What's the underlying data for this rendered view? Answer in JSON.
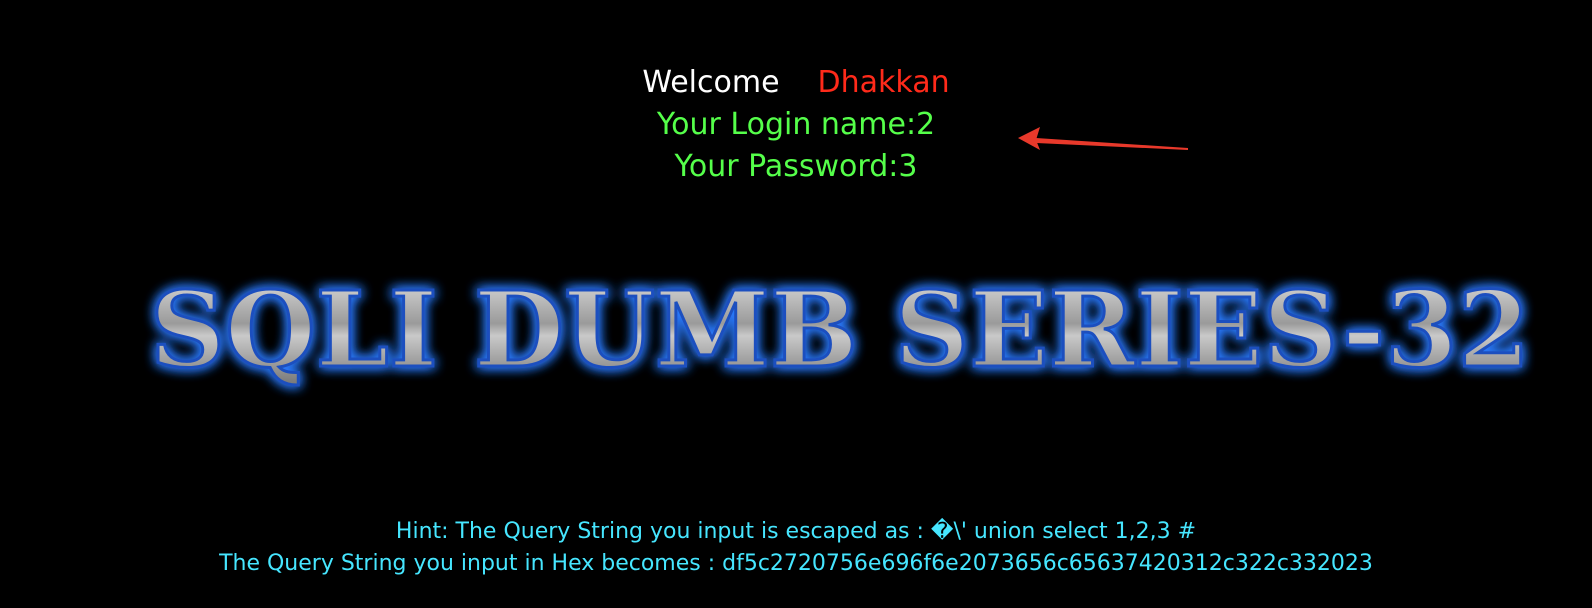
{
  "welcome": {
    "greeting": "Welcome",
    "user": "Dhakkan"
  },
  "login": {
    "name_label": "Your Login name:2",
    "password_label": "Your Password:3"
  },
  "banner": {
    "title": "SQLI DUMB SERIES-32"
  },
  "hint": {
    "escaped_text": "Hint: The Query String you input is escaped as : �\\' union select 1,2,3 #",
    "hex_text": "The Query String you input in Hex becomes : df5c2720756e696f6e2073656c65637420312c322c332023"
  },
  "colors": {
    "background": "#000000",
    "welcome": "#ffffff",
    "user": "#ff2a1a",
    "login_text": "#55ff4a",
    "hint_text": "#46e6ff",
    "arrow": "#e8392b",
    "banner_glow": "#2b7bff"
  },
  "icons": {
    "annotation": "arrow-icon"
  }
}
